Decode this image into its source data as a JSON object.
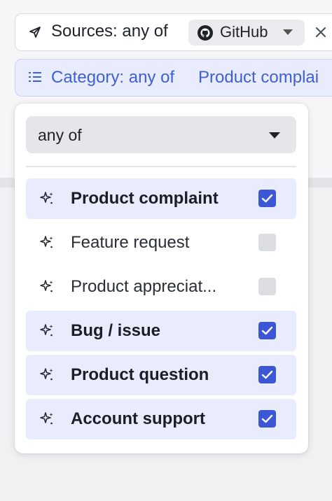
{
  "sources_filter": {
    "label": "Sources: any of",
    "chip_label": "GitHub"
  },
  "category_filter": {
    "label": "Category: any of",
    "value": "Product complai"
  },
  "dropdown": {
    "mode": "any of",
    "options": [
      {
        "label": "Product complaint",
        "checked": true
      },
      {
        "label": "Feature request",
        "checked": false
      },
      {
        "label": "Product appreciat...",
        "checked": false
      },
      {
        "label": "Bug / issue",
        "checked": true
      },
      {
        "label": "Product question",
        "checked": true
      },
      {
        "label": "Account support",
        "checked": true
      }
    ]
  },
  "colors": {
    "accent": "#3b57d6",
    "selected_row": "#e8ecfc",
    "category_text": "#3f5fd6"
  }
}
